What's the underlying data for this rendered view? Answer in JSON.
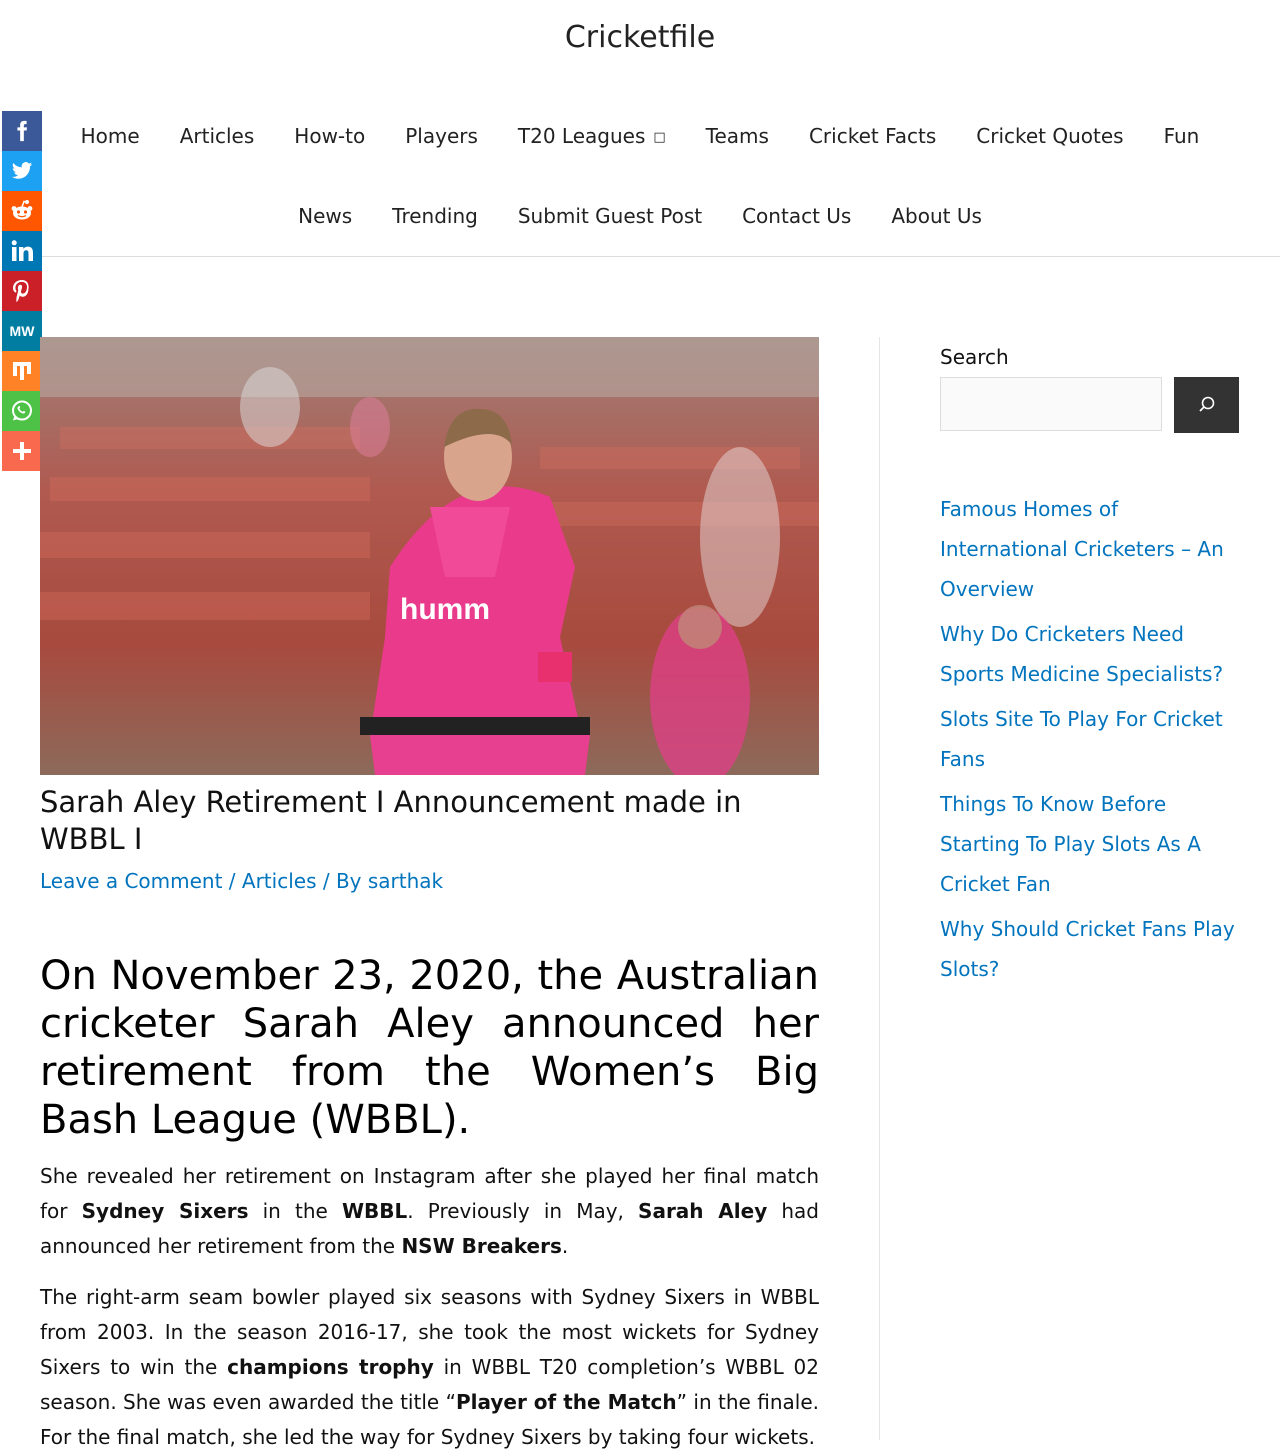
{
  "site": {
    "title": "Cricketfile"
  },
  "nav": {
    "row1": [
      "Home",
      "Articles",
      "How-to",
      "Players",
      "T20 Leagues",
      "Teams",
      "Cricket Facts",
      "Cricket Quotes",
      "Fun"
    ],
    "row2": [
      "News",
      "Trending",
      "Submit Guest Post",
      "Contact Us",
      "About Us"
    ]
  },
  "share": {
    "buttons": [
      {
        "name": "facebook",
        "color": "#3b5998"
      },
      {
        "name": "twitter",
        "color": "#1da1f2"
      },
      {
        "name": "reddit",
        "color": "#ff5700"
      },
      {
        "name": "linkedin",
        "color": "#0077b5"
      },
      {
        "name": "pinterest",
        "color": "#cb2027"
      },
      {
        "name": "mewe",
        "color": "#007da1"
      },
      {
        "name": "mix",
        "color": "#ff8226"
      },
      {
        "name": "whatsapp",
        "color": "#4dc247"
      },
      {
        "name": "more",
        "color": "#f8694d"
      }
    ]
  },
  "post": {
    "title": "Sarah Aley Retirement I Announcement made in WBBL I",
    "meta": {
      "comment": "Leave a Comment",
      "sep1": " / ",
      "category": "Articles",
      "sep2": " / By ",
      "author": "sarthak"
    },
    "lead": "On November 23, 2020, the Australian cricketer Sarah Aley announced her retirement from the Women’s Big Bash League (WBBL).",
    "p1": {
      "t1": "She revealed her retirement on Instagram after she played her final match for ",
      "b1": "Sydney Sixers",
      "t2": " in the ",
      "b2": "WBBL",
      "t3": ". Previously in May, ",
      "b3": "Sarah Aley",
      "t4": " had announced her retirement from the ",
      "b4": "NSW Breakers",
      "t5": "."
    },
    "p2": {
      "t1": "The right-arm seam bowler played six seasons with Sydney Sixers in WBBL from 2003. In the season 2016-17, she took the most wickets for Sydney Sixers to win the ",
      "b1": "champions trophy",
      "t2": " in WBBL T20 completion’s WBBL 02 season. She was even awarded the title “",
      "b2": "Player of the Match",
      "t3": "” in the finale. For the final match, she led the way for Sydney Sixers by taking four wickets."
    }
  },
  "sidebar": {
    "search_label": "Search",
    "recent_posts": [
      "Famous Homes of International Cricketers – An Overview",
      "Why Do Cricketers Need Sports Medicine Specialists?",
      "Slots Site To Play For Cricket Fans",
      "Things To Know Before Starting To Play Slots As A Cricket Fan",
      "Why Should Cricket Fans Play Slots?"
    ]
  }
}
